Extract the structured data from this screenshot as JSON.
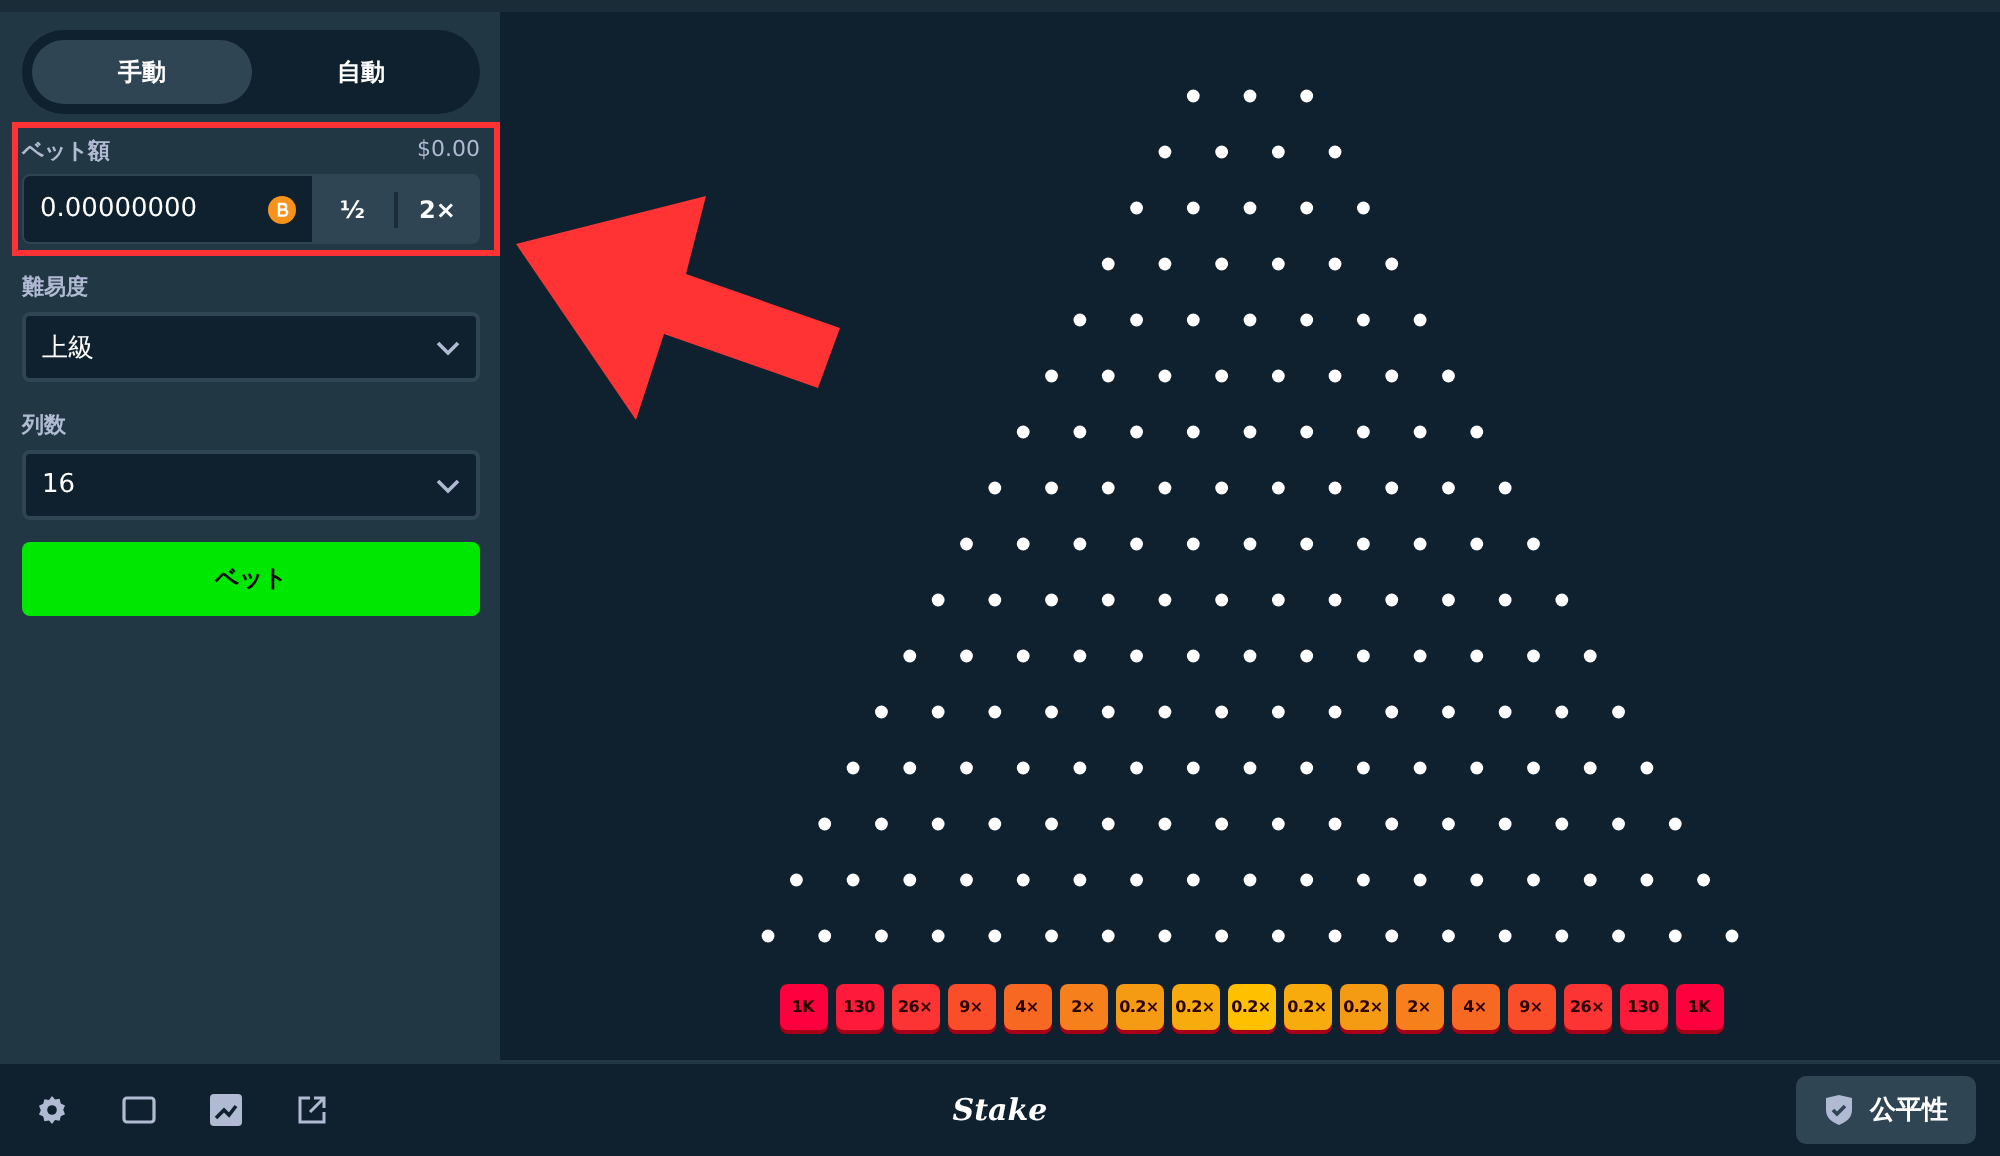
{
  "mode_tabs": [
    {
      "label": "手動",
      "selected": true
    },
    {
      "label": "自動",
      "selected": false
    }
  ],
  "bet_amount": {
    "label": "ベット額",
    "balance": "$0.00",
    "value": "0.00000000",
    "half_button": "½",
    "double_button": "2×"
  },
  "difficulty": {
    "label": "難易度",
    "value": "上級"
  },
  "rows": {
    "label": "列数",
    "value": "16"
  },
  "bet_button": "ベット",
  "multipliers": [
    {
      "label": "1K",
      "color": "#ff003f"
    },
    {
      "label": "130",
      "color": "#fe1a3a"
    },
    {
      "label": "26×",
      "color": "#fc3433"
    },
    {
      "label": "9×",
      "color": "#fa4e2b"
    },
    {
      "label": "4×",
      "color": "#f76823"
    },
    {
      "label": "2×",
      "color": "#f6801c"
    },
    {
      "label": "0.2×",
      "color": "#f59a13"
    },
    {
      "label": "0.2×",
      "color": "#f8ab0c"
    },
    {
      "label": "0.2×",
      "color": "#ffc000"
    },
    {
      "label": "0.2×",
      "color": "#f8ab0c"
    },
    {
      "label": "0.2×",
      "color": "#f59a13"
    },
    {
      "label": "2×",
      "color": "#f6801c"
    },
    {
      "label": "4×",
      "color": "#f76823"
    },
    {
      "label": "9×",
      "color": "#fa4e2b"
    },
    {
      "label": "26×",
      "color": "#fc3433"
    },
    {
      "label": "130",
      "color": "#fe1a3a"
    },
    {
      "label": "1K",
      "color": "#ff003f"
    }
  ],
  "footer": {
    "logo": "Stake",
    "fairness_button": "公平性"
  }
}
